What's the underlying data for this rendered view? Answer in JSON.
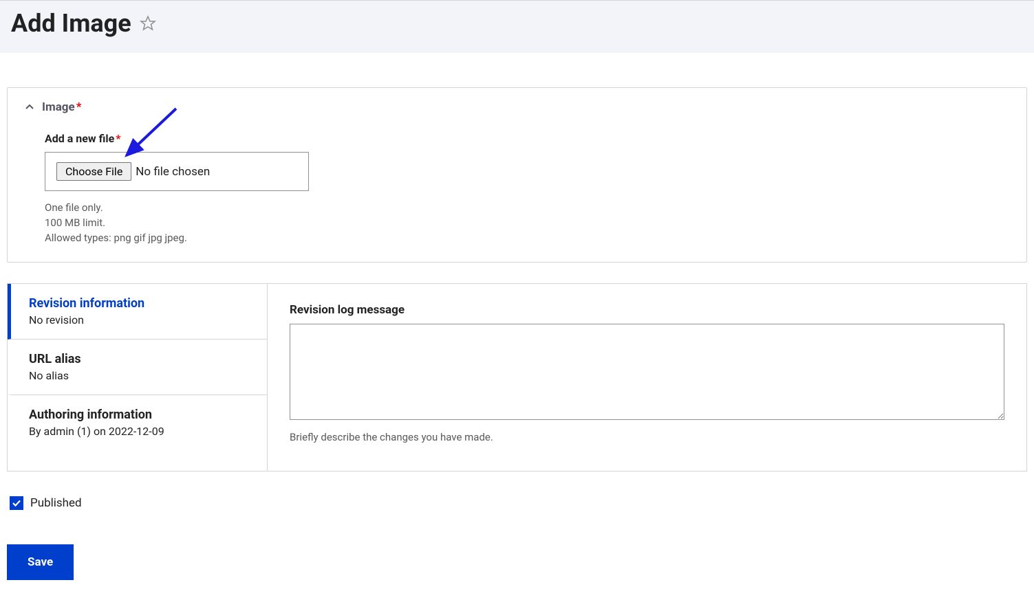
{
  "header": {
    "title": "Add Image"
  },
  "image_section": {
    "legend": "Image",
    "add_file_label": "Add a new file",
    "choose_file_button": "Choose File",
    "file_status": "No file chosen",
    "help_line1": "One file only.",
    "help_line2": "100 MB limit.",
    "help_line3": "Allowed types: png gif jpg jpeg."
  },
  "tabs": {
    "revision": {
      "title": "Revision information",
      "subtitle": "No revision"
    },
    "url_alias": {
      "title": "URL alias",
      "subtitle": "No alias"
    },
    "authoring": {
      "title": "Authoring information",
      "subtitle": "By admin (1) on 2022-12-09"
    }
  },
  "panel": {
    "log_label": "Revision log message",
    "log_help": "Briefly describe the changes you have made."
  },
  "published": {
    "label": "Published",
    "checked": true
  },
  "actions": {
    "save": "Save"
  }
}
